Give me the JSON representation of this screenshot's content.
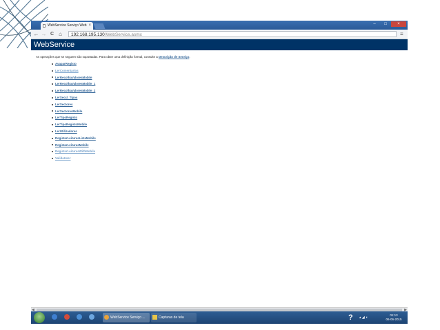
{
  "browser": {
    "tab_title": "WebService Serviço Web",
    "tab_close": "×",
    "url_host": "192.168.195.130",
    "url_path": "/WebService.asmx",
    "menu_icon": "≡",
    "back_icon": "←",
    "forward_icon": "→",
    "reload_icon": "C",
    "home_icon": "⌂",
    "minimize": "–",
    "maximize": "□",
    "close": "×"
  },
  "page": {
    "banner_title": "WebService",
    "intro_text": "As operações que se seguem são suportadas. Para obter uma definição formal, consulte a",
    "intro_link": "Descrição de Serviço",
    "intro_end": ".",
    "operations": [
      {
        "label": "AvaparRegisto",
        "visited": false
      },
      {
        "label": "LerComentarios",
        "visited": true
      },
      {
        "label": "LerRecolhaValoresMobile",
        "visited": false
      },
      {
        "label": "LerRecolhaValoresMobile_1",
        "visited": false
      },
      {
        "label": "LerRecolhaValoresMobile_2",
        "visited": false
      },
      {
        "label": "LerSeccl_Tipos",
        "visited": false
      },
      {
        "label": "LerSectores",
        "visited": false
      },
      {
        "label": "LerSectoresMobile",
        "visited": false
      },
      {
        "label": "LerTipoRegisto",
        "visited": false
      },
      {
        "label": "LerTipoRegistoMobile",
        "visited": false
      },
      {
        "label": "LerUtilizadores",
        "visited": false
      },
      {
        "label": "RegistarLeiturasListaMobile",
        "visited": false
      },
      {
        "label": "RegistarLeiturasMobile",
        "visited": false
      },
      {
        "label": "RegistarLeiturasWithMobile",
        "visited": true
      },
      {
        "label": "ValidaUser",
        "visited": true
      }
    ]
  },
  "taskbar": {
    "items": [
      {
        "label": "WebService Serviço ..."
      },
      {
        "label": "Capturas de tela"
      }
    ],
    "help_icon": "?",
    "time": "01:13",
    "date": "06-06-2015"
  }
}
